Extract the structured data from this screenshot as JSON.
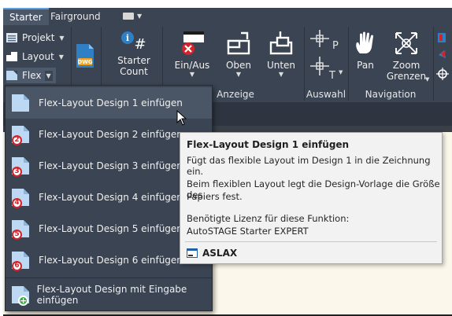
{
  "tabs": [
    {
      "label": "Starter",
      "active": true
    },
    {
      "label": "Fairground",
      "active": false
    }
  ],
  "ribbon": {
    "left_buttons": [
      {
        "label": "Projekt",
        "icon": "list-icon"
      },
      {
        "label": "Layout",
        "icon": "layout-icon"
      },
      {
        "label": "Flex",
        "icon": "flex-icon"
      }
    ],
    "dwg_label": "DWG",
    "starter_count": {
      "line1": "Starter",
      "line2": "Count"
    },
    "einaus": {
      "line1": "Ein/Aus"
    },
    "oben": {
      "line1": "Oben"
    },
    "unten": {
      "line1": "Unten"
    },
    "pan": {
      "line1": "Pan"
    },
    "zoom": {
      "line1": "Zoom",
      "line2": "Grenzen"
    },
    "panel_titles": {
      "anzeige": "Anzeige",
      "auswahl": "Auswahl",
      "navigation": "Navigation"
    },
    "glyphs": {
      "p": "P",
      "t": "T",
      "hash": "#",
      "info": "i"
    }
  },
  "menu": {
    "items": [
      {
        "label": "Flex-Layout Design 1 einfügen",
        "badge": ""
      },
      {
        "label": "Flex-Layout Design 2 einfügen",
        "badge": "2"
      },
      {
        "label": "Flex-Layout Design 3 einfügen",
        "badge": "3"
      },
      {
        "label": "Flex-Layout Design 4 einfügen",
        "badge": "4"
      },
      {
        "label": "Flex-Layout Design 5 einfügen",
        "badge": "5"
      },
      {
        "label": "Flex-Layout Design 6 einfügen",
        "badge": "6"
      },
      {
        "label": "Flex-Layout Design mit Eingabe einfügen",
        "badge": "+"
      }
    ]
  },
  "tooltip": {
    "title": "Flex-Layout Design 1 einfügen",
    "line1": "Fügt das flexible Layout im Design 1 in die Zeichnung ein.",
    "line2a": "Beim flexiblen Layout legt die Design-Vorlage die Größe des",
    "line2b": "Papiers fest.",
    "line3a": "Benötigte Lizenz für diese Funktion:",
    "line3b": "AutoSTAGE Starter EXPERT",
    "footer": "ASLAX"
  },
  "colors": {
    "ribbon_bg": "#3b4453",
    "accent": "#5aa0e6",
    "error_red": "#d4232a",
    "canvas": "#fbf7ea"
  }
}
